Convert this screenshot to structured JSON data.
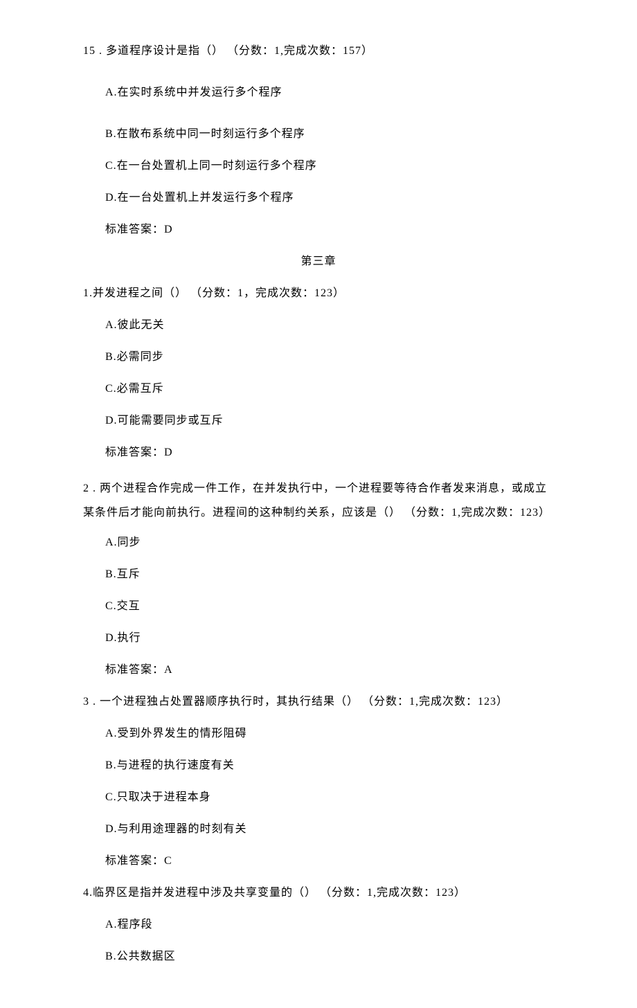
{
  "q15": {
    "stem": "15 . 多道程序设计是指（） （分数：1,完成次数：157）",
    "optA": "A.在实时系统中并发运行多个程序",
    "optB": "B.在散布系统中同一时刻运行多个程序",
    "optC": "C.在一台处置机上同一时刻运行多个程序",
    "optD": "D.在一台处置机上并发运行多个程序",
    "answer": "标准答案：D"
  },
  "section_title": "第三章",
  "q1": {
    "stem": "1.并发进程之间（） （分数：1，完成次数：123）",
    "optA": "A.彼此无关",
    "optB": "B.必需同步",
    "optC": "C.必需互斥",
    "optD": "D.可能需要同步或互斥",
    "answer": "标准答案：D"
  },
  "q2": {
    "stem": "2 . 两个进程合作完成一件工作，在并发执行中，一个进程要等待合作者发来消息，或成立某条件后才能向前执行。进程间的这种制约关系，应该是（） （分数：1,完成次数：123）",
    "optA": "A.同步",
    "optB": "B.互斥",
    "optC": "C.交互",
    "optD": "D.执行",
    "answer": "标准答案：A"
  },
  "q3": {
    "stem": "3 . 一个进程独占处置器顺序执行时，其执行结果（） （分数：1,完成次数：123）",
    "optA": "A.受到外界发生的情形阻碍",
    "optB": "B.与进程的执行速度有关",
    "optC": "C.只取决于进程本身",
    "optD": "D.与利用途理器的时刻有关",
    "answer": "标准答案：C"
  },
  "q4": {
    "stem": "4.临界区是指并发进程中涉及共享变量的（） （分数：1,完成次数：123）",
    "optA": "A.程序段",
    "optB": "B.公共数据区"
  }
}
